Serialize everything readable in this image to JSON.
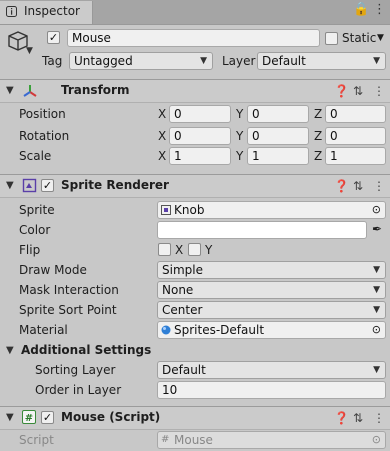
{
  "window": {
    "tab_title": "Inspector"
  },
  "object": {
    "active": true,
    "name": "Mouse",
    "static_label": "Static",
    "tag_label": "Tag",
    "tag_value": "Untagged",
    "layer_label": "Layer",
    "layer_value": "Default"
  },
  "transform": {
    "title": "Transform",
    "position_label": "Position",
    "rotation_label": "Rotation",
    "scale_label": "Scale",
    "axis": {
      "x": "X",
      "y": "Y",
      "z": "Z"
    },
    "position": {
      "x": "0",
      "y": "0",
      "z": "0"
    },
    "rotation": {
      "x": "0",
      "y": "0",
      "z": "0"
    },
    "scale": {
      "x": "1",
      "y": "1",
      "z": "1"
    }
  },
  "sprite_renderer": {
    "title": "Sprite Renderer",
    "sprite_label": "Sprite",
    "sprite_value": "Knob",
    "color_label": "Color",
    "color_value": "#ffffff",
    "flip_label": "Flip",
    "flip_x": "X",
    "flip_y": "Y",
    "draw_mode_label": "Draw Mode",
    "draw_mode_value": "Simple",
    "mask_label": "Mask Interaction",
    "mask_value": "None",
    "sort_point_label": "Sprite Sort Point",
    "sort_point_value": "Center",
    "material_label": "Material",
    "material_value": "Sprites-Default",
    "additional_title": "Additional Settings",
    "sorting_layer_label": "Sorting Layer",
    "sorting_layer_value": "Default",
    "order_label": "Order in Layer",
    "order_value": "10"
  },
  "script_component": {
    "title": "Mouse (Script)",
    "script_label": "Script",
    "script_value": "Mouse"
  },
  "colors": {
    "background": "#c8c8c8",
    "header": "#cbcbcb",
    "field": "#f0f0f0"
  }
}
